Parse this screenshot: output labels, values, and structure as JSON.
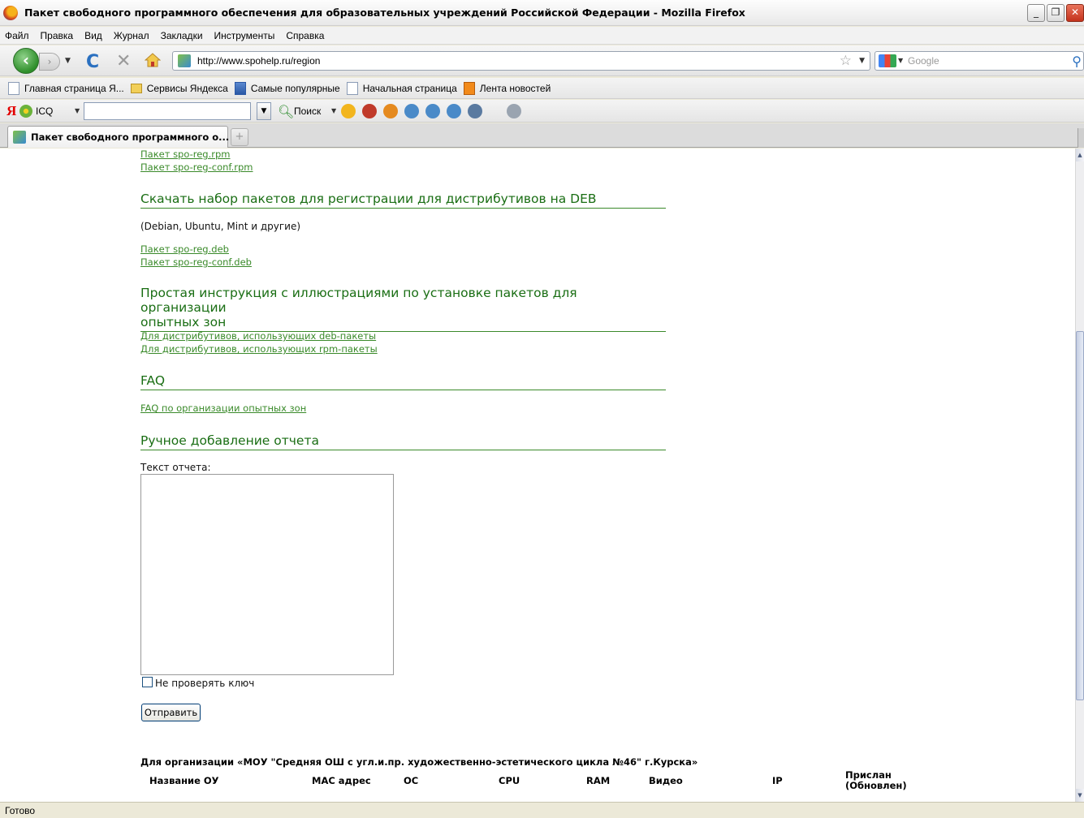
{
  "window": {
    "title": "Пакет свободного программного обеспечения для образовательных учреждений Российской Федерации - Mozilla Firefox"
  },
  "menu": [
    "Файл",
    "Правка",
    "Вид",
    "Журнал",
    "Закладки",
    "Инструменты",
    "Справка"
  ],
  "nav": {
    "url": "http://www.spohelp.ru/region",
    "search_placeholder": "Google"
  },
  "bookmarks": [
    {
      "label": "Главная страница Я...",
      "icon": "page-icon"
    },
    {
      "label": "Сервисы Яндекса",
      "icon": "folder-icon"
    },
    {
      "label": "Самые популярные",
      "icon": "star-folder-icon"
    },
    {
      "label": "Начальная страница",
      "icon": "page-icon"
    },
    {
      "label": "Лента новостей",
      "icon": "rss-icon"
    }
  ],
  "yandex_bar": {
    "logo": "Я",
    "icq_label": "ICQ",
    "search_label": "Поиск"
  },
  "tab": {
    "title": "Пакет свободного программного о..."
  },
  "content": {
    "rpm_links": [
      "Пакет spo-reg.rpm",
      "Пакет spo-reg-conf.rpm"
    ],
    "deb_section_title": "Скачать набор пакетов для регистрации для дистрибутивов на DEB",
    "deb_note": "(Debian, Ubuntu, Mint и другие)",
    "deb_links": [
      "Пакет spo-reg.deb",
      "Пакет spo-reg-conf.deb"
    ],
    "instruction_title_line1": "Простая инструкция с иллюстрациями по установке пакетов для организации",
    "instruction_title_line2": "опытных зон",
    "instruction_links": [
      "Для дистрибутивов, использующих deb-пакеты",
      "Для дистрибутивов, использующих rpm-пакеты"
    ],
    "faq_title": "FAQ",
    "faq_link": "FAQ по организации опытных зон",
    "manual_title": "Ручное добавление отчета",
    "report_label": "Текст отчета:",
    "no_check_key_label": "Не проверять ключ",
    "submit_label": "Отправить",
    "org_heading": "Для организации «МОУ \"Средняя ОШ с угл.и.пр. художественно-эстетического цикла №46\" г.Курска»",
    "columns": [
      "Название ОУ",
      "MAC адрес",
      "ОС",
      "CPU",
      "RAM",
      "Видео",
      "IP",
      "Прислан",
      "(Обновлен)"
    ]
  },
  "status": "Готово"
}
